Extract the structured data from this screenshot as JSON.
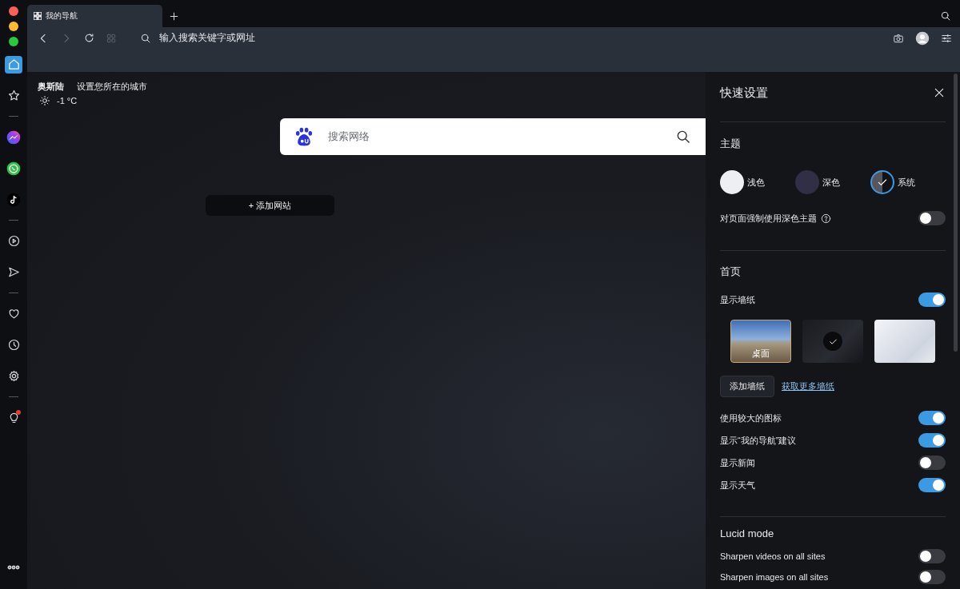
{
  "tabs": [
    {
      "title": "我的导航",
      "selected": true
    }
  ],
  "address_bar": {
    "placeholder": "输入搜索关键字或网址"
  },
  "sidebar": {
    "groups": [
      [
        {
          "kind": "home",
          "selected": true,
          "notification": false
        },
        {
          "kind": "bookmarks",
          "selected": false,
          "notification": false
        }
      ],
      [
        {
          "kind": "messenger",
          "selected": false,
          "notification": false
        },
        {
          "kind": "whatsapp",
          "selected": false,
          "notification": false
        },
        {
          "kind": "tiktok",
          "selected": false,
          "notification": false
        }
      ],
      [
        {
          "kind": "player",
          "selected": false,
          "notification": false
        },
        {
          "kind": "flow",
          "selected": false,
          "notification": false
        }
      ],
      [
        {
          "kind": "favorites",
          "selected": false,
          "notification": false
        },
        {
          "kind": "history",
          "selected": false,
          "notification": false
        },
        {
          "kind": "settings",
          "selected": false,
          "notification": false
        }
      ],
      [
        {
          "kind": "tips",
          "selected": false,
          "notification": true
        }
      ]
    ]
  },
  "weather": {
    "city": "奥斯陆",
    "set_city_link": "设置您所在的城市",
    "temperature": "-1 °C"
  },
  "search": {
    "placeholder": "搜索网络"
  },
  "speed_dial": {
    "add_button": "+ 添加网站"
  },
  "quick_settings": {
    "title": "快速设置",
    "theme": {
      "heading": "主题",
      "options": [
        {
          "kind": "light",
          "label": "浅色",
          "selected": false
        },
        {
          "kind": "dark",
          "label": "深色",
          "selected": false
        },
        {
          "kind": "system",
          "label": "系统",
          "selected": true
        }
      ],
      "force_dark": {
        "label": "对页面强制使用深色主题",
        "on": false
      }
    },
    "homepage": {
      "heading": "首页",
      "show_wallpaper": {
        "label": "显示墙纸",
        "on": true
      },
      "wallpapers": [
        {
          "kind": "photo",
          "caption": "桌面",
          "selected": false
        },
        {
          "kind": "dark",
          "selected": true
        },
        {
          "kind": "light",
          "selected": false
        }
      ],
      "add_wallpaper_button": "添加墙纸",
      "more_wallpapers_link": "获取更多墙纸",
      "toggles": [
        {
          "label": "使用较大的图标",
          "on": true
        },
        {
          "label": "显示“我的导航”建议",
          "on": true
        },
        {
          "label": "显示新闻",
          "on": false
        },
        {
          "label": "显示天气",
          "on": true
        }
      ]
    },
    "lucid_mode": {
      "heading": "Lucid mode",
      "toggles": [
        {
          "label": "Sharpen videos on all sites",
          "on": false
        },
        {
          "label": "Sharpen images on all sites",
          "on": false
        }
      ]
    }
  }
}
